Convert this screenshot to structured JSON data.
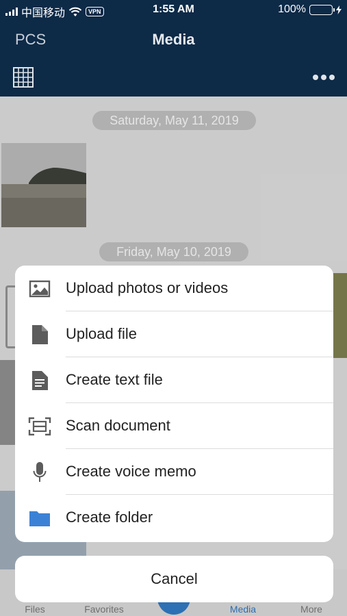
{
  "status": {
    "carrier": "中国移动",
    "vpn": "VPN",
    "time": "1:55 AM",
    "battery": "100%"
  },
  "nav": {
    "back_label": "PCS",
    "title": "Media"
  },
  "content": {
    "sections": [
      {
        "date": "Saturday, May 11, 2019"
      },
      {
        "date": "Friday, May 10, 2019"
      }
    ]
  },
  "sheet": {
    "actions": [
      {
        "label": "Upload photos or videos",
        "icon": "image-icon"
      },
      {
        "label": "Upload file",
        "icon": "file-icon"
      },
      {
        "label": "Create text file",
        "icon": "text-file-icon"
      },
      {
        "label": "Scan document",
        "icon": "scan-icon"
      },
      {
        "label": "Create voice memo",
        "icon": "microphone-icon"
      },
      {
        "label": "Create folder",
        "icon": "folder-icon"
      }
    ],
    "cancel_label": "Cancel"
  },
  "tabs": [
    {
      "label": "Files"
    },
    {
      "label": "Favorites"
    },
    {
      "label": "Media"
    },
    {
      "label": "More"
    }
  ],
  "colors": {
    "header": "#0d2a47",
    "accent": "#2f6db0",
    "folder": "#3b82d6",
    "battery": "#4cd964"
  }
}
